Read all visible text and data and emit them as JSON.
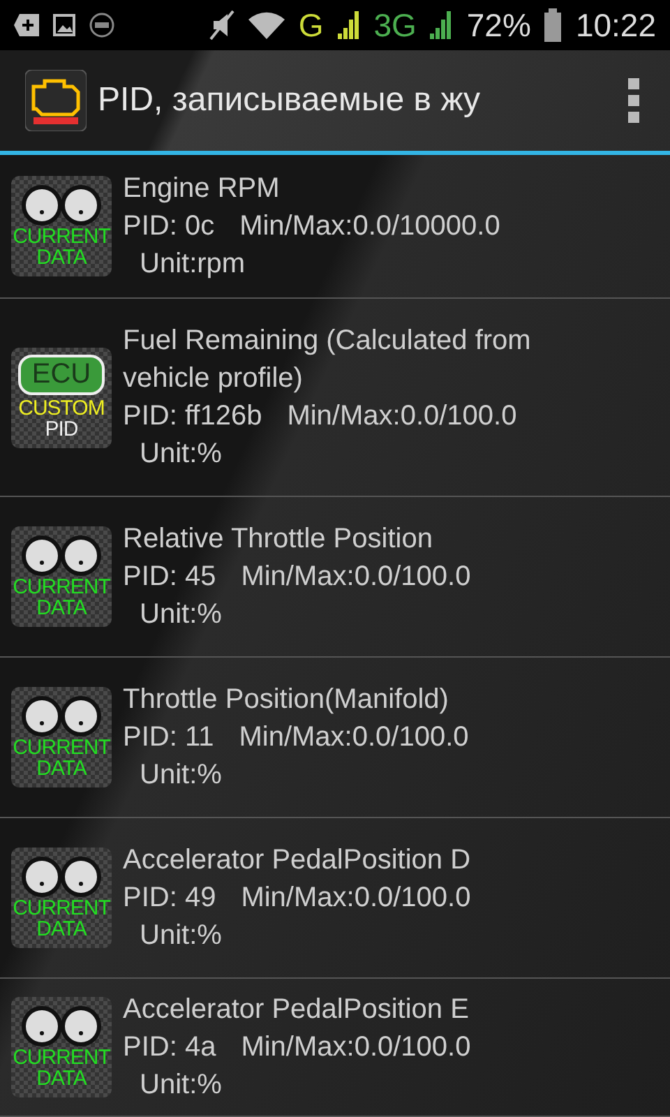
{
  "status_bar": {
    "network": "G",
    "network_2": "3G",
    "battery": "72%",
    "time": "10:22"
  },
  "action_bar": {
    "title": "PID, записываемые в жу"
  },
  "rows": [
    {
      "kind": "current",
      "badge": [
        "CURRENT",
        "DATA"
      ],
      "name": "Engine RPM",
      "pid": "PID: 0c",
      "minmax": "Min/Max:0.0/10000.0",
      "unit": "Unit:rpm"
    },
    {
      "kind": "custom",
      "badge_top": "ECU",
      "badge": [
        "CUSTOM",
        "PID"
      ],
      "name": "Fuel Remaining (Calculated from vehicle profile)",
      "pid": "PID: ff126b",
      "minmax": "Min/Max:0.0/100.0",
      "unit": "Unit:%"
    },
    {
      "kind": "current",
      "badge": [
        "CURRENT",
        "DATA"
      ],
      "name": "Relative Throttle Position",
      "pid": "PID: 45",
      "minmax": "Min/Max:0.0/100.0",
      "unit": "Unit:%"
    },
    {
      "kind": "current",
      "badge": [
        "CURRENT",
        "DATA"
      ],
      "name": "Throttle Position(Manifold)",
      "pid": "PID: 11",
      "minmax": "Min/Max:0.0/100.0",
      "unit": "Unit:%"
    },
    {
      "kind": "current",
      "badge": [
        "CURRENT",
        "DATA"
      ],
      "name": "Accelerator PedalPosition D",
      "pid": "PID: 49",
      "minmax": "Min/Max:0.0/100.0",
      "unit": "Unit:%"
    },
    {
      "kind": "current",
      "badge": [
        "CURRENT",
        "DATA"
      ],
      "name": "Accelerator PedalPosition E",
      "pid": "PID: 4a",
      "minmax": "Min/Max:0.0/100.0",
      "unit": "Unit:%"
    }
  ]
}
